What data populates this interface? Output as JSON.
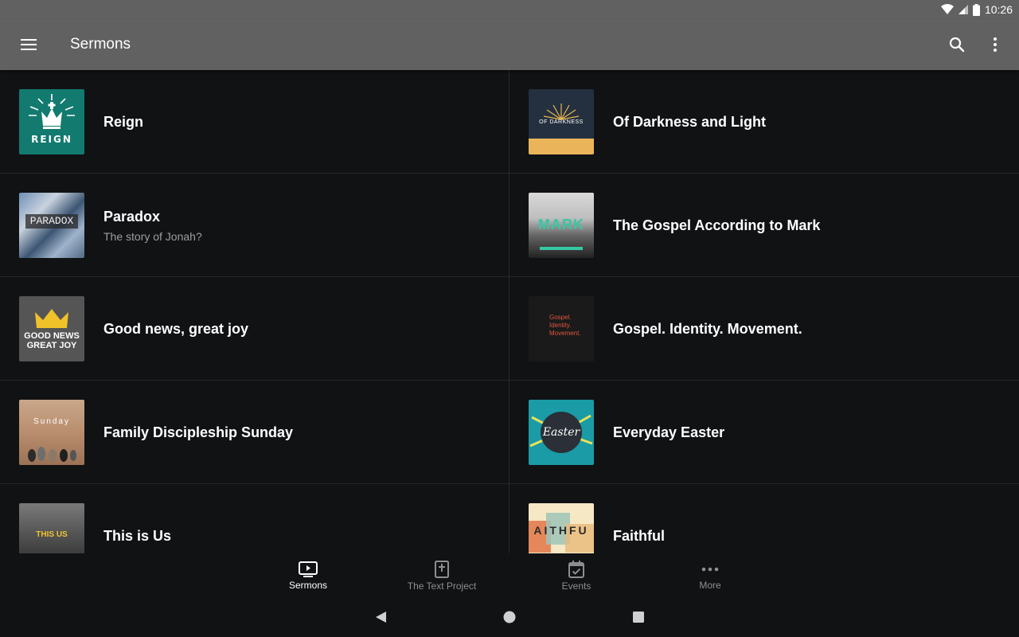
{
  "status": {
    "time": "10:26"
  },
  "app_bar": {
    "title": "Sermons"
  },
  "items": [
    {
      "title": "Reign",
      "subtitle": "",
      "thumb_text": "REIGN"
    },
    {
      "title": "Of Darkness and Light",
      "subtitle": "",
      "thumb_text": "OF DARKNESS"
    },
    {
      "title": "Paradox",
      "subtitle": "The story of Jonah?",
      "thumb_text": "PARADOX"
    },
    {
      "title": "The Gospel According to Mark",
      "subtitle": "",
      "thumb_text": "MARK"
    },
    {
      "title": "Good news, great joy",
      "subtitle": "",
      "thumb_text": "GOOD NEWS GREAT JOY"
    },
    {
      "title": "Gospel. Identity. Movement.",
      "subtitle": "",
      "thumb_text": "Gospel. Identity. Movement."
    },
    {
      "title": "Family Discipleship Sunday",
      "subtitle": "",
      "thumb_text": "Sunday"
    },
    {
      "title": "Everyday Easter",
      "subtitle": "",
      "thumb_text": "Easter"
    },
    {
      "title": "This is Us",
      "subtitle": "",
      "thumb_text": "THIS US"
    },
    {
      "title": "Faithful",
      "subtitle": "",
      "thumb_text": "AITHFU"
    }
  ],
  "bottom_nav": [
    {
      "label": "Sermons",
      "icon": "tv-play-icon",
      "active": true
    },
    {
      "label": "The Text Project",
      "icon": "bible-icon",
      "active": false
    },
    {
      "label": "Events",
      "icon": "calendar-check-icon",
      "active": false
    },
    {
      "label": "More",
      "icon": "more-horiz-icon",
      "active": false
    }
  ]
}
